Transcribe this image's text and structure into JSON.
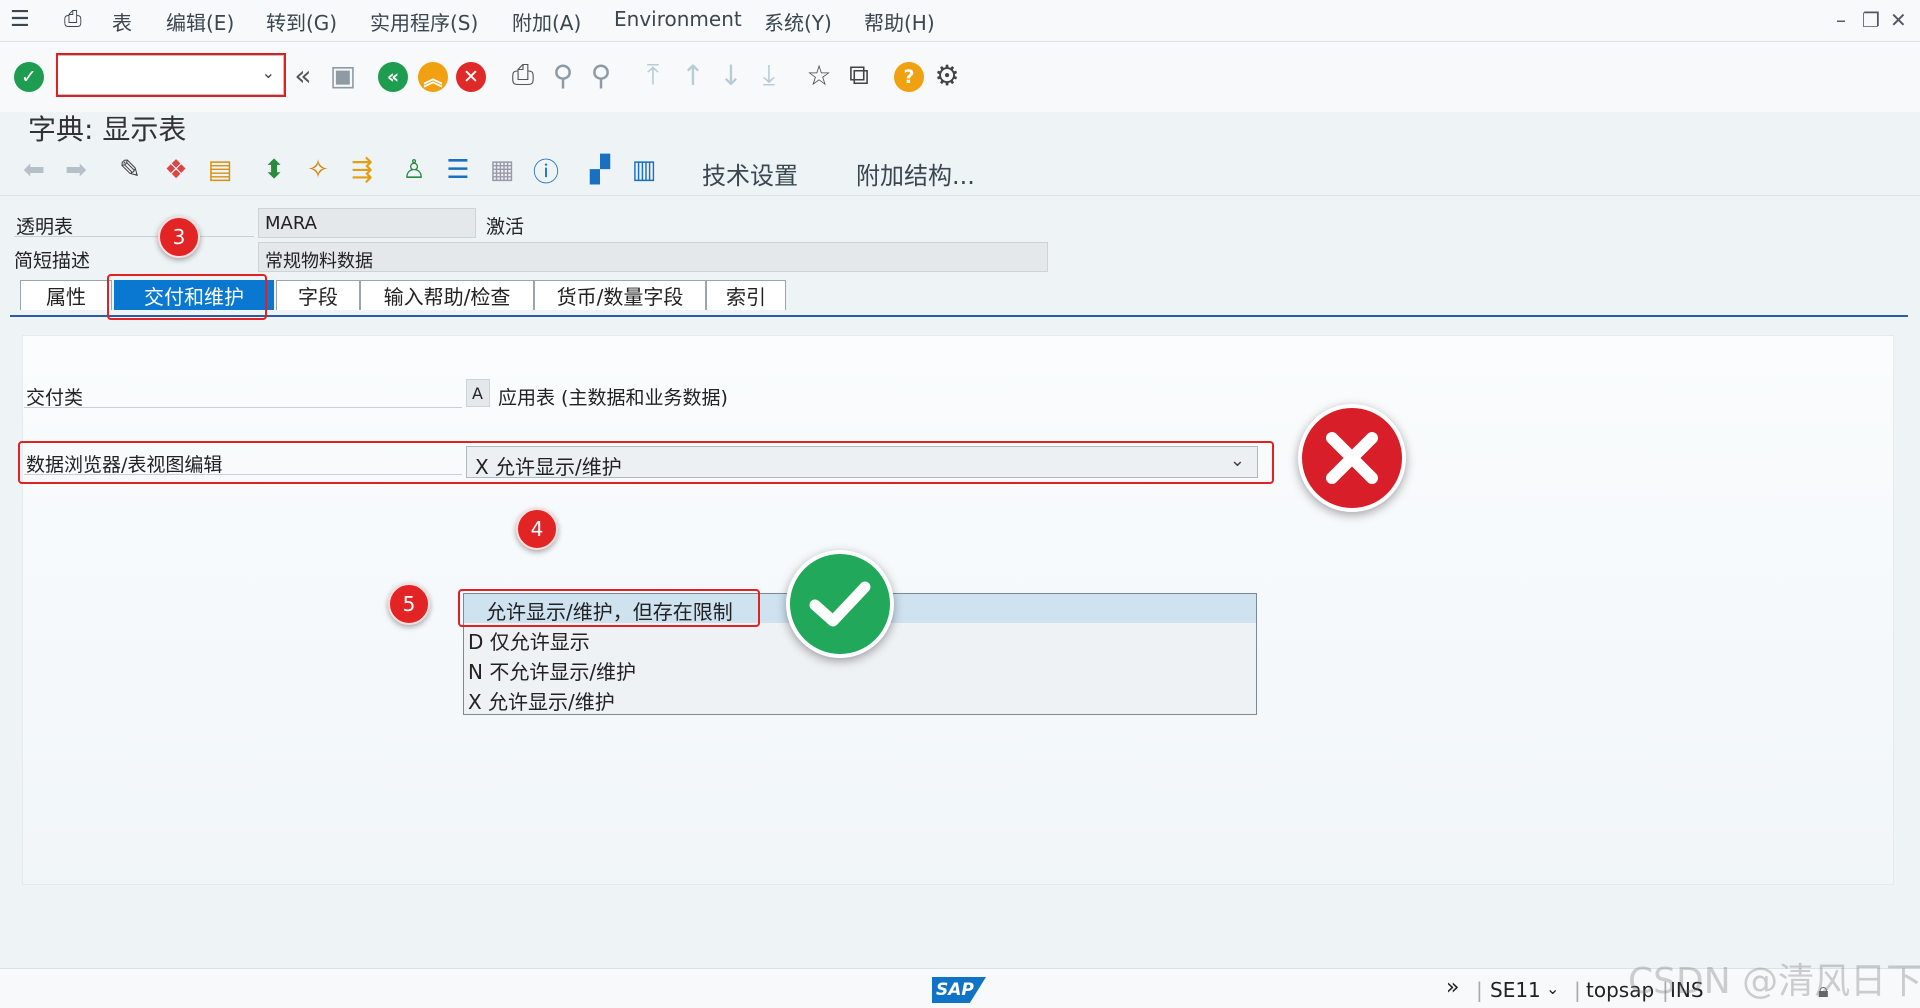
{
  "menu": {
    "items": [
      "表",
      "编辑(E)",
      "转到(G)",
      "实用程序(S)",
      "附加(A)",
      "Environment",
      "系统(Y)",
      "帮助(H)"
    ]
  },
  "window_controls": [
    "–",
    "❐",
    "✕"
  ],
  "screen": {
    "title": "字典: 显示表"
  },
  "app_toolbar": {
    "tech_settings": "技术设置",
    "append_structure": "附加结构..."
  },
  "header": {
    "table_label": "透明表",
    "table_value": "MARA",
    "status": "激活",
    "desc_label": "简短描述",
    "desc_value": "常规物料数据"
  },
  "tabs": [
    "属性",
    "交付和维护",
    "字段",
    "输入帮助/检查",
    "货币/数量字段",
    "索引"
  ],
  "content": {
    "delivery_class_label": "交付类",
    "delivery_class_value": "A",
    "delivery_class_desc": "应用表 (主数据和业务数据)",
    "browser_label": "数据浏览器/表视图编辑",
    "browser_value": "X 允许显示/维护"
  },
  "popup_options": [
    "允许显示/维护，但存在限制",
    "D 仅允许显示",
    "N 不允许显示/维护",
    "X 允许显示/维护"
  ],
  "annotations": {
    "badge3": "3",
    "badge4": "4",
    "badge5": "5"
  },
  "status_bar": {
    "transaction": "SE11",
    "server": "topsap",
    "mode": "INS",
    "sap_logo": "SAP"
  },
  "watermark": "CSDN @清风日下",
  "colors": {
    "active_tab": "#0a78d1",
    "annotation_red": "#e22424",
    "check_green": "#22a85a"
  }
}
